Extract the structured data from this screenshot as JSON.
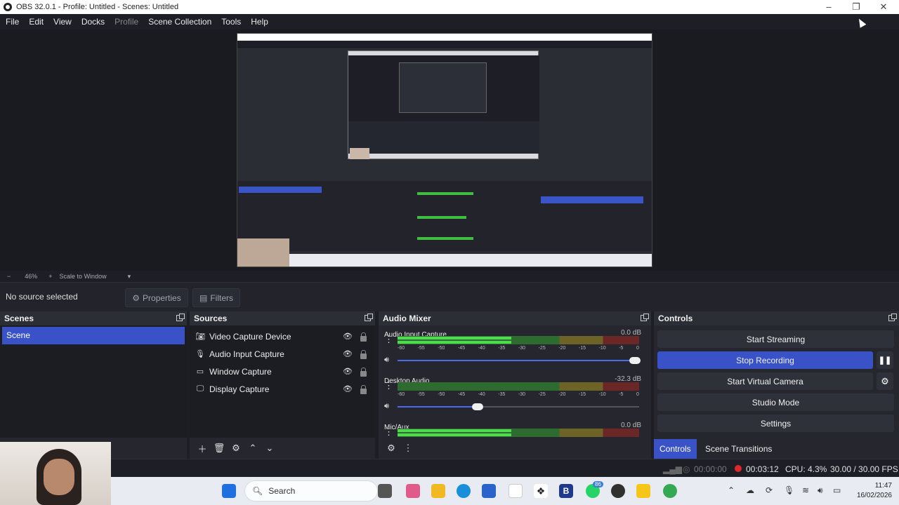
{
  "window": {
    "title": "OBS 32.0.1 - Profile: Untitled - Scenes: Untitled"
  },
  "menu": [
    "File",
    "Edit",
    "View",
    "Docks",
    "Profile",
    "Scene Collection",
    "Tools",
    "Help"
  ],
  "zoom": {
    "minus": "−",
    "value": "46%",
    "plus": "+",
    "scale": "Scale to Window"
  },
  "source_bar": {
    "no_source": "No source selected",
    "properties": "Properties",
    "filters": "Filters"
  },
  "scenes": {
    "title": "Scenes",
    "items": [
      "Scene"
    ]
  },
  "sources": {
    "title": "Sources",
    "items": [
      {
        "label": "Video Capture Device",
        "icon": "camera-icon"
      },
      {
        "label": "Audio Input Capture",
        "icon": "microphone-icon"
      },
      {
        "label": "Window Capture",
        "icon": "window-icon"
      },
      {
        "label": "Display Capture",
        "icon": "monitor-icon"
      }
    ]
  },
  "mixer": {
    "title": "Audio Mixer",
    "ticks": [
      "-60",
      "-55",
      "-50",
      "-45",
      "-40",
      "-35",
      "-30",
      "-25",
      "-20",
      "-15",
      "-10",
      "-5",
      "0"
    ],
    "channels": [
      {
        "name": "Audio Input Capture",
        "db": "0.0 dB",
        "level": 0.47,
        "volume": 1.0
      },
      {
        "name": "Desktop Audio",
        "db": "-32.3 dB",
        "level": 0.0,
        "volume": 0.35
      },
      {
        "name": "Mic/Aux",
        "db": "0.0 dB",
        "level": 0.47,
        "volume": 1.0
      }
    ]
  },
  "controls": {
    "title": "Controls",
    "start_streaming": "Start Streaming",
    "stop_recording": "Stop Recording",
    "start_virtual_camera": "Start Virtual Camera",
    "studio_mode": "Studio Mode",
    "settings": "Settings",
    "tab_controls": "Controls",
    "tab_transitions": "Scene Transitions"
  },
  "status": {
    "stream_time": "00:00:00",
    "rec_time": "00:03:12",
    "cpu": "CPU: 4.3%",
    "fps": "30.00 / 30.00 FPS"
  },
  "taskbar": {
    "search": "Search",
    "time": "11:47",
    "date": "16/02/2026",
    "badge": "86"
  },
  "colors": {
    "accent": "#3952c7",
    "meter_green": "#4fdb4f",
    "rec_red": "#e0282c"
  }
}
